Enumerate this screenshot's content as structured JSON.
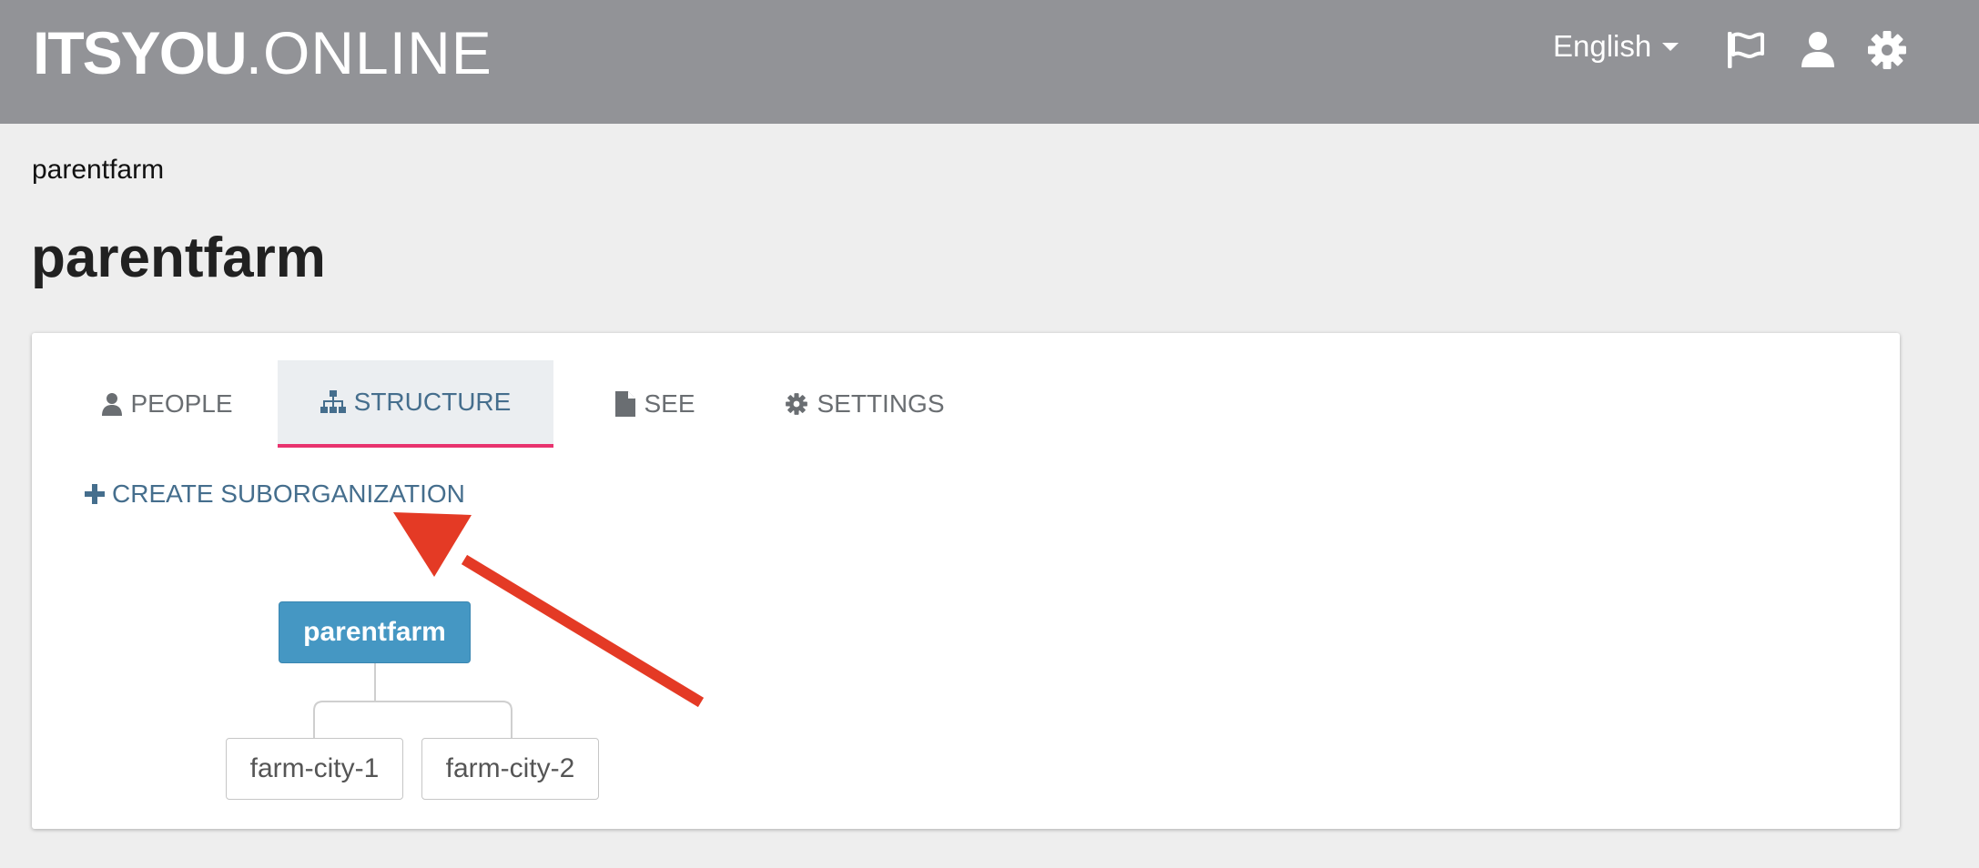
{
  "header": {
    "logo_bold": "ITSYOU",
    "logo_light": ".ONLINE",
    "language": "English",
    "icons": [
      "flag-icon",
      "user-icon",
      "gear-icon"
    ]
  },
  "breadcrumb": "parentfarm",
  "page_title": "parentfarm",
  "tabs": [
    {
      "label": "PEOPLE",
      "icon": "user-icon",
      "active": false
    },
    {
      "label": "STRUCTURE",
      "icon": "sitemap-icon",
      "active": true
    },
    {
      "label": "SEE",
      "icon": "file-icon",
      "active": false
    },
    {
      "label": "SETTINGS",
      "icon": "gear-icon",
      "active": false
    }
  ],
  "create_sub_label": "CREATE SUBORGANIZATION",
  "tree": {
    "root": "parentfarm",
    "children": [
      "farm-city-1",
      "farm-city-2"
    ]
  },
  "colors": {
    "topbar": "#929397",
    "accent_tab_underline": "#e8336e",
    "link": "#456e8d",
    "root_node": "#4597c3",
    "annotation_arrow": "#e43a25"
  }
}
